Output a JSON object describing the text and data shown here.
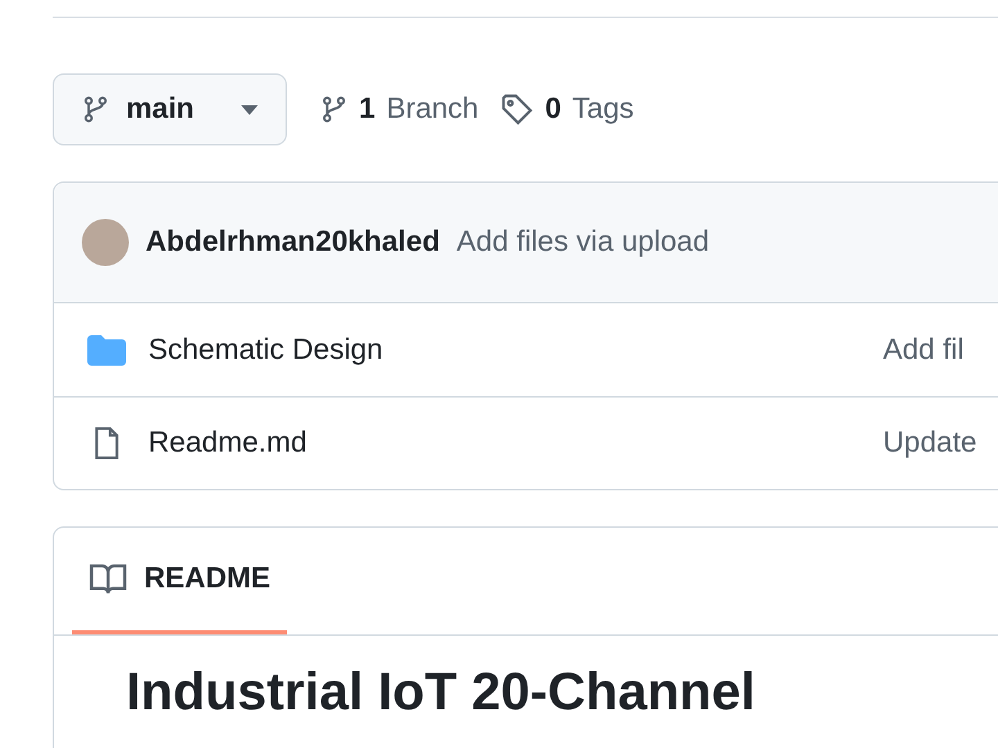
{
  "branch_selector": {
    "label": "main"
  },
  "branch_count": {
    "count": "1",
    "label": "Branch"
  },
  "tag_count": {
    "count": "0",
    "label": "Tags"
  },
  "latest_commit": {
    "author": "Abdelrhman20khaled",
    "message": "Add files via upload"
  },
  "files": [
    {
      "kind": "folder",
      "name": "Schematic Design",
      "commit_message": "Add fil"
    },
    {
      "kind": "file",
      "name": "Readme.md",
      "commit_message": "Update"
    }
  ],
  "readme": {
    "tabs": [
      {
        "label": "README",
        "selected": true
      }
    ],
    "heading": "Industrial IoT 20-Channel"
  }
}
